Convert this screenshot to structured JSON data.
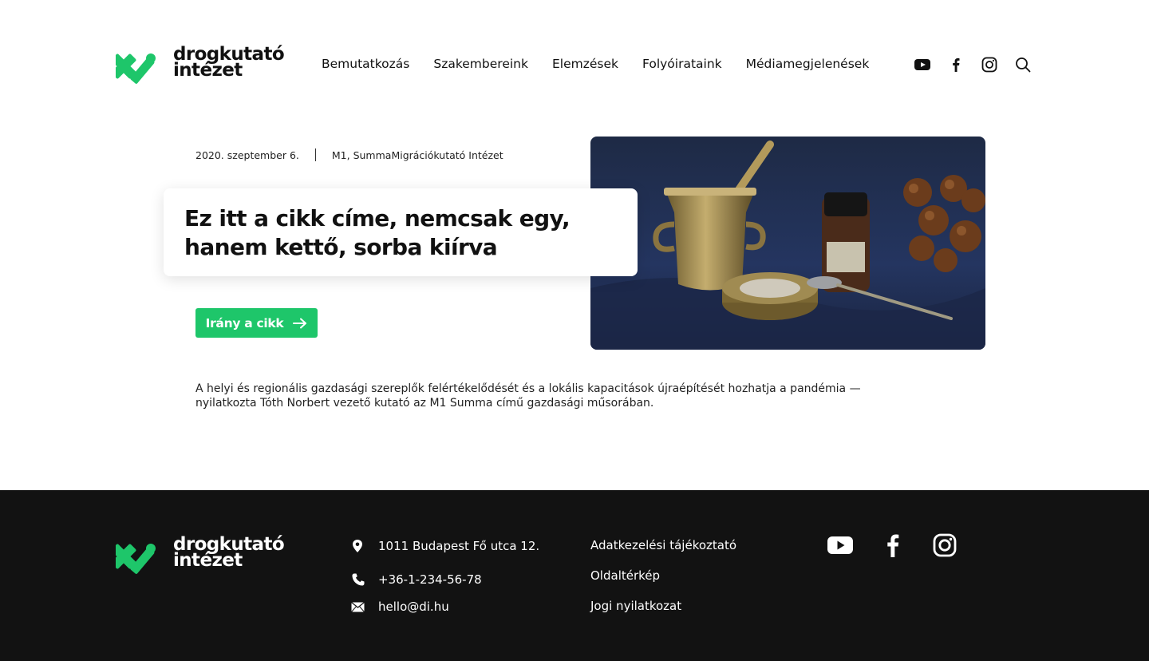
{
  "brand": {
    "name_line1": "drogkutató",
    "name_line2": "intézet",
    "accent": "#1ec66a"
  },
  "nav": {
    "items": [
      "Bemutatkozás",
      "Szakembereink",
      "Elemzések",
      "Folyóirataink",
      "Médiamegjelenések"
    ]
  },
  "header_icons": [
    "youtube-icon",
    "facebook-icon",
    "instagram-icon",
    "search-icon"
  ],
  "article": {
    "date": "2020. szeptember 6.",
    "source": "M1, SummaMigrációkutató Intézet",
    "title": "Ez itt a cikk címe, nemcsak egy, hanem kettő, sorba kiírva",
    "cta_label": "Irány a cikk",
    "lead": "A helyi és regionális gazdasági szereplők felértékelődését és a lokális kapacitások újraépítését hozhatja a pandémia — nyilatkozta Tóth Norbert vezető kutató az M1 Summa című gazdasági műsorában."
  },
  "footer": {
    "address": "1011 Budapest Fő utca 12.",
    "phone": "+36-1-234-56-78",
    "email": "hello@di.hu",
    "links": [
      "Adatkezelési tájékoztató",
      "Oldaltérkép",
      "Jogi nyilatkozat"
    ],
    "social": [
      "youtube-icon",
      "facebook-icon",
      "instagram-icon"
    ],
    "background": "#121212"
  }
}
